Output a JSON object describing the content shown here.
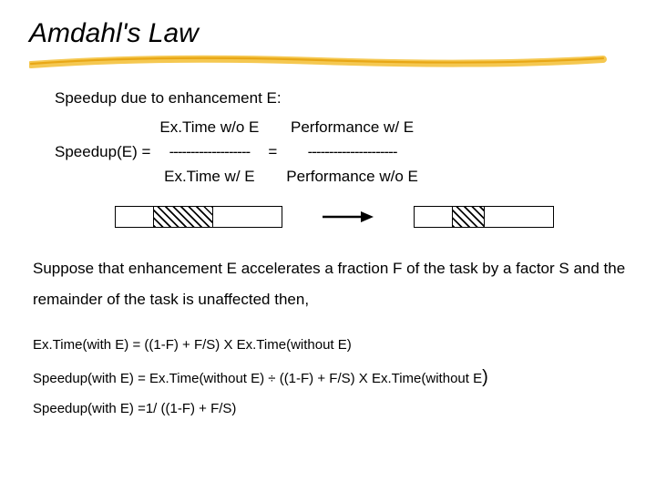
{
  "title": "Amdahl's Law",
  "subtitle": "Speedup  due to enhancement E:",
  "formula": {
    "lhs": "Speedup(E) =",
    "frac1": {
      "top": "Ex.Time w/o E",
      "mid": "-------------------",
      "bot": "Ex.Time w/  E"
    },
    "equals": "=",
    "frac2": {
      "top": "Performance w/  E",
      "mid": "---------------------",
      "bot": "Performance w/o E"
    }
  },
  "paragraph": "Suppose that enhancement E accelerates a fraction F of the task by a factor S and the remainder of the task is unaffected then,",
  "eq1": "Ex.Time(with E)  = ((1-F) + F/S) X Ex.Time(without E)",
  "eq2_a": "Speedup(with E) = Ex.Time(without E) ÷ ((1-F) + F/S) X Ex.Time(without E",
  "eq2_b": ")",
  "eq3": "Speedup(with E) =1/ ((1-F) + F/S)"
}
